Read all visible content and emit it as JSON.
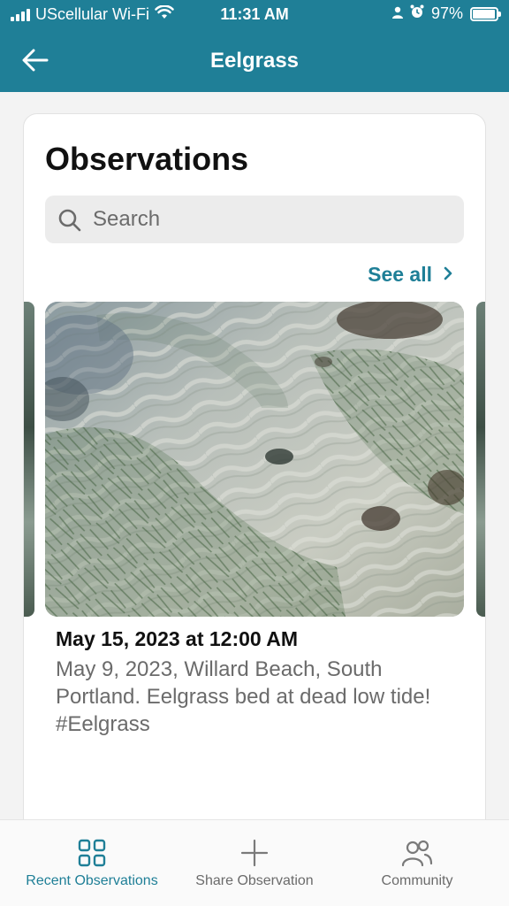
{
  "status_bar": {
    "carrier": "UScellular Wi-Fi",
    "time": "11:31 AM",
    "battery": "97%",
    "battery_level": 0.97
  },
  "app_bar": {
    "title": "Eelgrass",
    "back_icon": "arrow-left-icon"
  },
  "main": {
    "title": "Observations",
    "search": {
      "placeholder": "Search",
      "value": ""
    },
    "see_all_label": "See all",
    "observation": {
      "date": "May 15, 2023 at 12:00 AM",
      "description": "May 9, 2023, Willard Beach, South Portland. Eelgrass bed at dead low tide! #Eelgrass"
    }
  },
  "tab_bar": {
    "tabs": [
      {
        "label": "Recent Observations",
        "icon": "grid-icon",
        "active": true
      },
      {
        "label": "Share Observation",
        "icon": "plus-icon",
        "active": false
      },
      {
        "label": "Community",
        "icon": "users-icon",
        "active": false
      }
    ]
  },
  "colors": {
    "brand": "#1f7f97",
    "text": "#111111",
    "muted": "#6b6b6b"
  }
}
